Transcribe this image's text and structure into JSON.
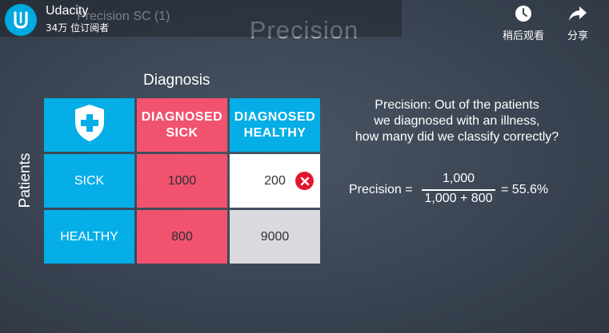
{
  "overlay": {
    "channel_name": "Udacity",
    "subscribers": "34万 位订阅者",
    "video_title": "Precision SC (1)",
    "logo_icon": "udacity-logo-icon",
    "actions": [
      {
        "label": "稍后观看",
        "icon": "clock-icon"
      },
      {
        "label": "分享",
        "icon": "share-arrow-icon"
      }
    ]
  },
  "slide": {
    "title": "Precision",
    "diagnosis_label": "Diagnosis",
    "patients_label": "Patients",
    "matrix": {
      "corner_icon": "shield-medical-cross-icon",
      "col_headers": [
        "DIAGNOSED\nSICK",
        "DIAGNOSED\nHEALTHY"
      ],
      "row_headers": [
        "SICK",
        "HEALTHY"
      ],
      "cells": [
        [
          "1000",
          "200"
        ],
        [
          "800",
          "9000"
        ]
      ],
      "error_icon": "x-circle-icon"
    },
    "description": "Precision: Out of the patients\nwe diagnosed with an illness,\nhow many did we classify correctly?",
    "formula": {
      "label": "Precision =",
      "numerator": "1,000",
      "denominator": "1,000 + 800",
      "result": "= 55.6%"
    },
    "colors": {
      "blue": "#05aee6",
      "pink": "#f1536e",
      "white": "#ffffff",
      "grey": "#d9d9de",
      "error_red": "#e3162e"
    }
  }
}
